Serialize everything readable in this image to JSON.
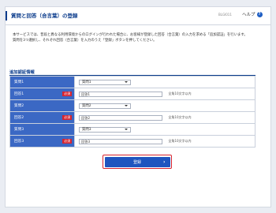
{
  "header": {
    "title": "質問と回答（合言葉）の登録",
    "screen_id": "BLGI011",
    "help_label": "ヘルプ",
    "help_icon": "?"
  },
  "description": [
    "本サービスでは、普段と異なる利用環境からのログインが行われた場合に、お客様が登録した回答（合言葉）の入力を求める「追加認証」を行います。",
    "質問を3つ選択し、それぞれ回答（合言葉）を入力のうえ「登録」ボタンを押してください。"
  ],
  "section": {
    "title": "追加認証情報"
  },
  "rows": [
    {
      "label": "質問1",
      "kind": "select",
      "value": "質問1"
    },
    {
      "label": "回答1",
      "kind": "input",
      "required": "必須",
      "value": "回答1",
      "hint": "全角10文字以内"
    },
    {
      "label": "質問2",
      "kind": "select",
      "value": "質問2"
    },
    {
      "label": "回答2",
      "kind": "input",
      "required": "必須",
      "value": "回答2",
      "hint": "全角10文字以内"
    },
    {
      "label": "質問3",
      "kind": "select",
      "value": "質問3"
    },
    {
      "label": "回答3",
      "kind": "input",
      "required": "必須",
      "value": "回答3",
      "hint": "全角10文字以内"
    }
  ],
  "submit": {
    "label": "登録",
    "chevron": "›"
  },
  "colors": {
    "brand": "#0b3c8c",
    "label_bg": "#3b68c4",
    "button": "#1f55bf",
    "required": "#d6242f"
  }
}
